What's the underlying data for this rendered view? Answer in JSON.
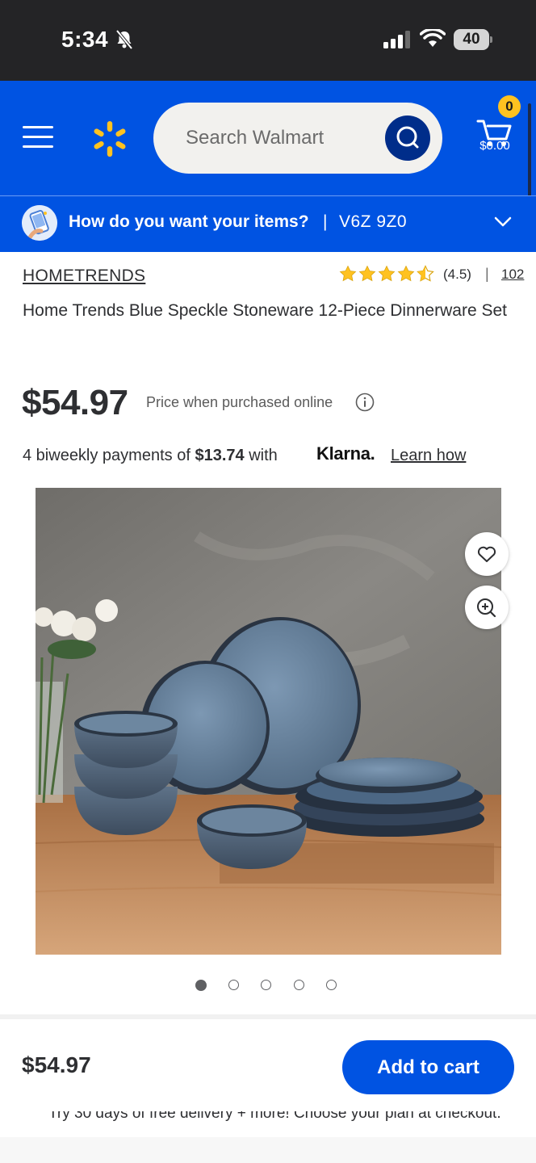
{
  "status_bar": {
    "time": "5:34",
    "battery": "40"
  },
  "header": {
    "search": {
      "placeholder": "Search Walmart"
    },
    "cart": {
      "count": "0",
      "total": "$0.00"
    }
  },
  "delivery": {
    "prompt": "How do you want your items?",
    "separator": "|",
    "zip": "V6Z 9Z0"
  },
  "product": {
    "brand": "HOMETRENDS",
    "rating_value": 4.5,
    "rating_text": "(4.5)",
    "rating_separator": "|",
    "review_count": "102",
    "title": "Home Trends Blue Speckle Stoneware 12-Piece Dinnerware Set",
    "price": "$54.97",
    "price_note": "Price when purchased online",
    "payments": {
      "prefix": "4 biweekly payments of",
      "amount": "$13.74",
      "with": "with",
      "provider": "Klarna.",
      "learn": "Learn how"
    },
    "image_count": 5,
    "active_image": 0
  },
  "bottom_bar": {
    "price": "$54.97",
    "add_to_cart": "Add to cart",
    "promo": "Try 30 days of free delivery + more! Choose your plan at checkout."
  },
  "colors": {
    "brand_blue": "#0053e2",
    "search_button": "#002d8a",
    "spark_yellow": "#ffc220",
    "star": "#ffc220"
  }
}
